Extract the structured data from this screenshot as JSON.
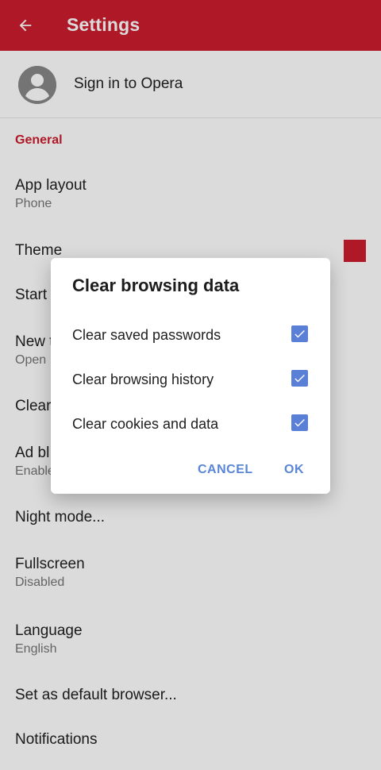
{
  "appbar": {
    "title": "Settings",
    "back_icon": "arrow-left-icon"
  },
  "account": {
    "signin_label": "Sign in to Opera",
    "avatar_icon": "person-icon"
  },
  "general": {
    "header": "General",
    "items": [
      {
        "title": "App layout",
        "subtitle": "Phone"
      },
      {
        "title": "Theme",
        "swatch_color": "#cc1d2d"
      },
      {
        "title": "Start"
      },
      {
        "title": "New t",
        "subtitle": "Open"
      },
      {
        "title": "Clear"
      },
      {
        "title": "Ad bl",
        "subtitle": "Enable"
      },
      {
        "title": "Night mode..."
      },
      {
        "title": "Fullscreen",
        "subtitle": "Disabled"
      },
      {
        "title": "Language",
        "subtitle": "English"
      },
      {
        "title": "Set as default browser..."
      },
      {
        "title": "Notifications"
      }
    ]
  },
  "dialog": {
    "title": "Clear browsing data",
    "options": [
      {
        "label": "Clear saved passwords",
        "checked": true
      },
      {
        "label": "Clear browsing history",
        "checked": true
      },
      {
        "label": "Clear cookies and data",
        "checked": true
      }
    ],
    "cancel_label": "CANCEL",
    "ok_label": "OK"
  },
  "colors": {
    "brand_red": "#cc1d2d",
    "accent_blue": "#5a7fd6",
    "scrim": "rgba(0,0,0,0.14)"
  }
}
